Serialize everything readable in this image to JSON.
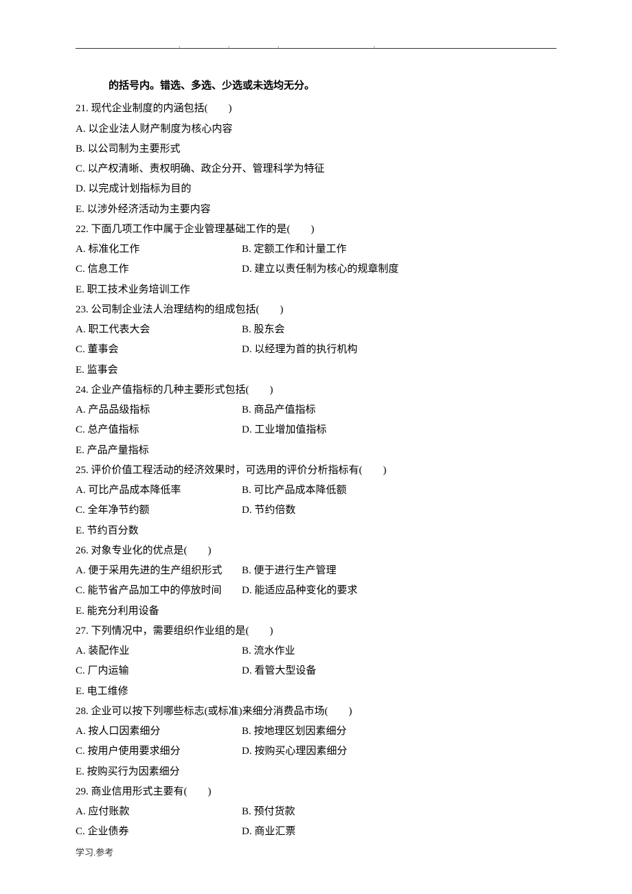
{
  "instruction": "的括号内。错选、多选、少选或未选均无分。",
  "questions": [
    {
      "num": "21",
      "stem": "现代企业制度的内涵包括(　　)",
      "options": [
        {
          "label": "A",
          "text": "以企业法人财产制度为核心内容"
        },
        {
          "label": "B",
          "text": "以公司制为主要形式"
        },
        {
          "label": "C",
          "text": "以产权清晰、责权明确、政企分开、管理科学为特征"
        },
        {
          "label": "D",
          "text": "以完成计划指标为目的"
        },
        {
          "label": "E",
          "text": "以涉外经济活动为主要内容"
        }
      ],
      "layout": "stack"
    },
    {
      "num": "22",
      "stem": "下面几项工作中属于企业管理基础工作的是(　　)",
      "options": [
        {
          "label": "A",
          "text": "标准化工作"
        },
        {
          "label": "B",
          "text": "定额工作和计量工作"
        },
        {
          "label": "C",
          "text": "信息工作"
        },
        {
          "label": "D",
          "text": "建立以责任制为核心的规章制度"
        },
        {
          "label": "E",
          "text": "职工技术业务培训工作"
        }
      ],
      "layout": "two-col"
    },
    {
      "num": "23",
      "stem": "公司制企业法人治理结构的组成包括(　　)",
      "options": [
        {
          "label": "A",
          "text": "职工代表大会"
        },
        {
          "label": "B",
          "text": "股东会"
        },
        {
          "label": "C",
          "text": "董事会"
        },
        {
          "label": "D",
          "text": "以经理为首的执行机构"
        },
        {
          "label": "E",
          "text": "监事会"
        }
      ],
      "layout": "two-col"
    },
    {
      "num": "24",
      "stem": "企业产值指标的几种主要形式包括(　　)",
      "options": [
        {
          "label": "A",
          "text": "产品品级指标"
        },
        {
          "label": "B",
          "text": "商品产值指标"
        },
        {
          "label": "C",
          "text": "总产值指标"
        },
        {
          "label": "D",
          "text": "工业增加值指标"
        },
        {
          "label": "E",
          "text": "产品产量指标"
        }
      ],
      "layout": "two-col"
    },
    {
      "num": "25",
      "stem": "评价价值工程活动的经济效果时，可选用的评价分析指标有(　　)",
      "options": [
        {
          "label": "A",
          "text": "可比产品成本降低率"
        },
        {
          "label": "B",
          "text": "可比产品成本降低额"
        },
        {
          "label": "C",
          "text": "全年净节约额"
        },
        {
          "label": "D",
          "text": "节约倍数"
        },
        {
          "label": "E",
          "text": "节约百分数"
        }
      ],
      "layout": "two-col"
    },
    {
      "num": "26",
      "stem": "对象专业化的优点是(　　)",
      "options": [
        {
          "label": "A",
          "text": "便于采用先进的生产组织形式"
        },
        {
          "label": "B",
          "text": "便于进行生产管理"
        },
        {
          "label": "C",
          "text": "能节省产品加工中的停放时间"
        },
        {
          "label": "D",
          "text": "能适应品种变化的要求"
        },
        {
          "label": "E",
          "text": "能充分利用设备"
        }
      ],
      "layout": "two-col"
    },
    {
      "num": "27",
      "stem": "下列情况中，需要组织作业组的是(　　)",
      "options": [
        {
          "label": "A",
          "text": "装配作业"
        },
        {
          "label": "B",
          "text": "流水作业"
        },
        {
          "label": "C",
          "text": "厂内运输"
        },
        {
          "label": "D",
          "text": "看管大型设备"
        },
        {
          "label": "E",
          "text": "电工维修"
        }
      ],
      "layout": "two-col"
    },
    {
      "num": "28",
      "stem": "企业可以按下列哪些标志(或标准)来细分消费品市场(　　)",
      "options": [
        {
          "label": "A",
          "text": "按人口因素细分"
        },
        {
          "label": "B",
          "text": "按地理区划因素细分"
        },
        {
          "label": "C",
          "text": "按用户使用要求细分"
        },
        {
          "label": "D",
          "text": "按购买心理因素细分"
        },
        {
          "label": "E",
          "text": "按购买行为因素细分"
        }
      ],
      "layout": "two-col"
    },
    {
      "num": "29",
      "stem": "商业信用形式主要有(　　)",
      "options": [
        {
          "label": "A",
          "text": "应付账款"
        },
        {
          "label": "B",
          "text": "预付货款"
        },
        {
          "label": "C",
          "text": "企业债券"
        },
        {
          "label": "D",
          "text": "商业汇票"
        }
      ],
      "layout": "two-col"
    }
  ],
  "footer": "学习.参考"
}
